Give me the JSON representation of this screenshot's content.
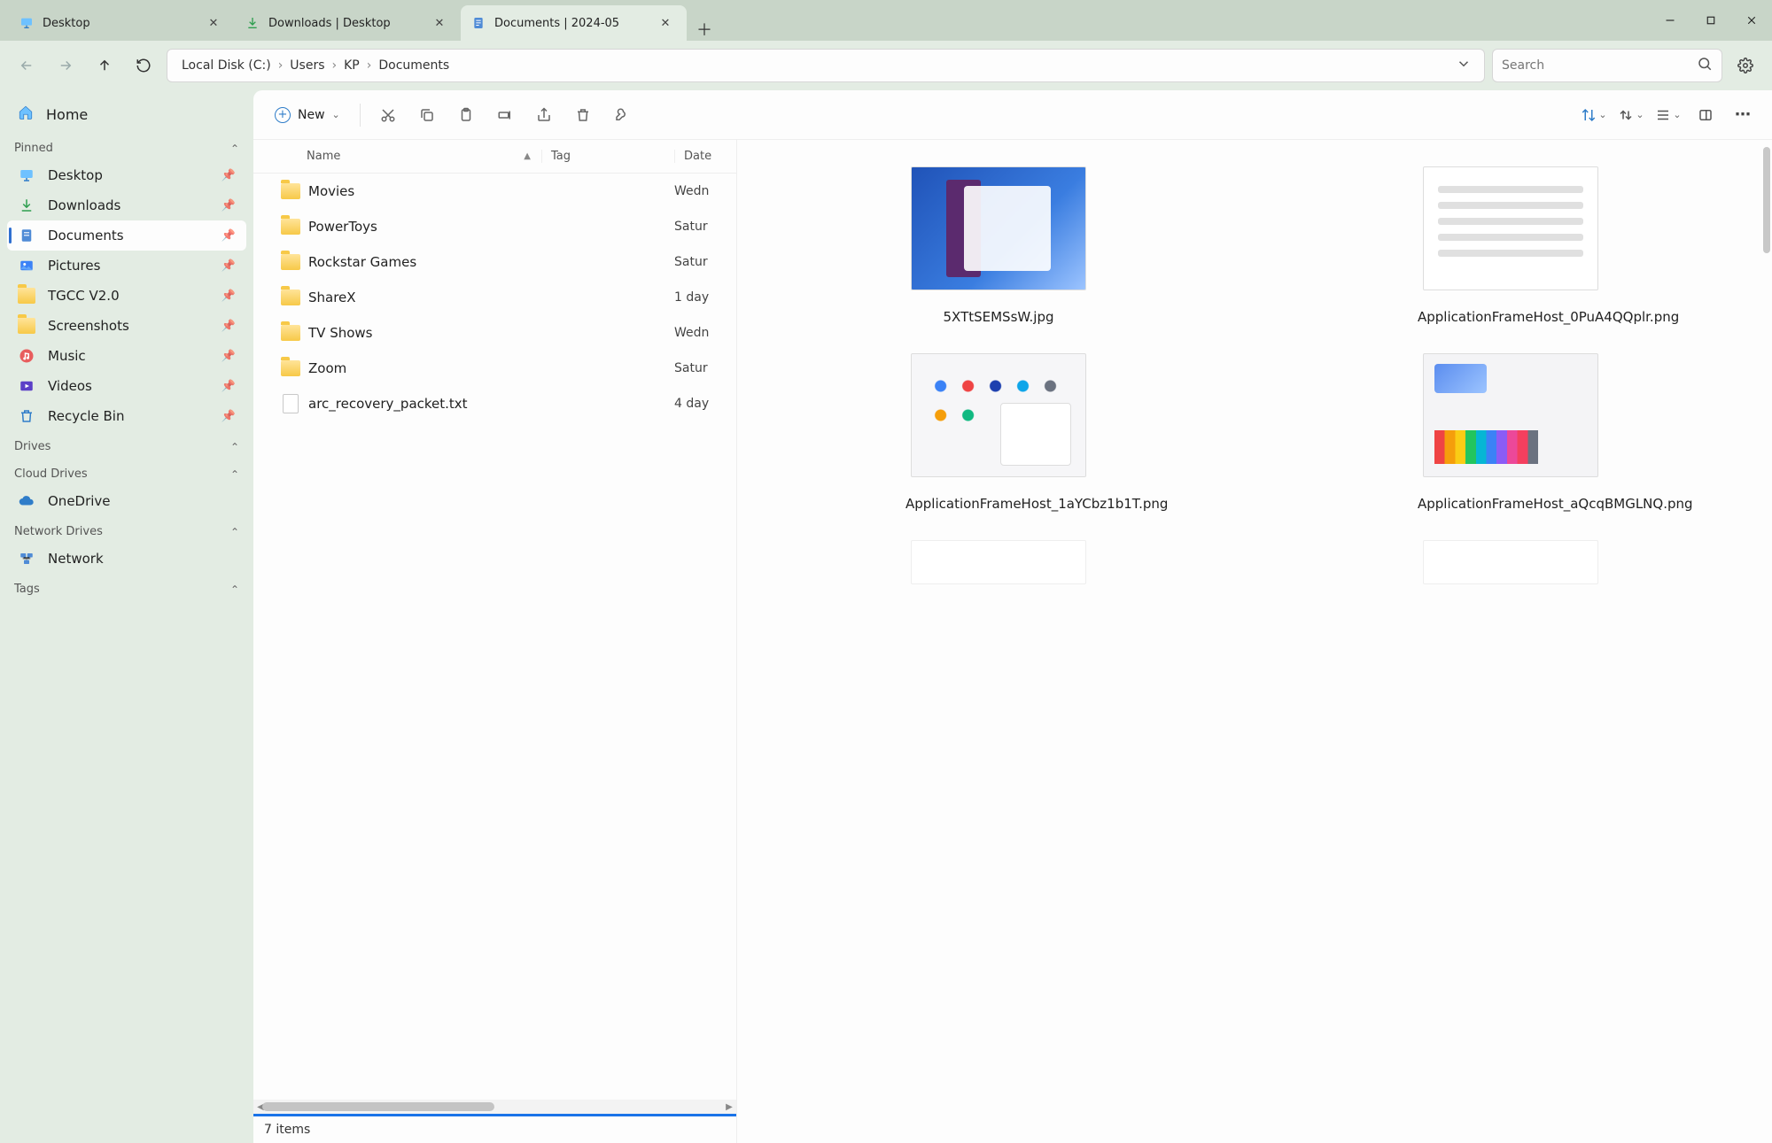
{
  "tabs": [
    {
      "label": "Desktop",
      "icon": "monitor",
      "active": false
    },
    {
      "label": "Downloads | Desktop",
      "icon": "download",
      "active": false
    },
    {
      "label": "Documents | 2024-05",
      "icon": "document",
      "active": true
    }
  ],
  "breadcrumb": [
    "Local Disk (C:)",
    "Users",
    "KP",
    "Documents"
  ],
  "search": {
    "placeholder": "Search"
  },
  "toolbar": {
    "new_label": "New"
  },
  "sidebar": {
    "home_label": "Home",
    "sections": {
      "pinned": {
        "title": "Pinned",
        "items": [
          {
            "label": "Desktop",
            "icon": "monitor"
          },
          {
            "label": "Downloads",
            "icon": "download"
          },
          {
            "label": "Documents",
            "icon": "document",
            "selected": true
          },
          {
            "label": "Pictures",
            "icon": "pictures"
          },
          {
            "label": "TGCC V2.0",
            "icon": "folder"
          },
          {
            "label": "Screenshots",
            "icon": "folder"
          },
          {
            "label": "Music",
            "icon": "music"
          },
          {
            "label": "Videos",
            "icon": "video"
          },
          {
            "label": "Recycle Bin",
            "icon": "recycle"
          }
        ]
      },
      "drives": {
        "title": "Drives"
      },
      "cloud": {
        "title": "Cloud Drives",
        "items": [
          {
            "label": "OneDrive",
            "icon": "cloud"
          }
        ]
      },
      "network": {
        "title": "Network Drives",
        "items": [
          {
            "label": "Network",
            "icon": "network"
          }
        ]
      },
      "tags": {
        "title": "Tags"
      }
    }
  },
  "columns": {
    "name": "Name",
    "tag": "Tag",
    "date": "Date"
  },
  "rows": [
    {
      "name": "Movies",
      "type": "folder",
      "date": "Wedn"
    },
    {
      "name": "PowerToys",
      "type": "folder",
      "date": "Satur"
    },
    {
      "name": "Rockstar Games",
      "type": "folder",
      "date": "Satur"
    },
    {
      "name": "ShareX",
      "type": "folder",
      "date": "1 day"
    },
    {
      "name": "TV Shows",
      "type": "folder",
      "date": "Wedn"
    },
    {
      "name": "Zoom",
      "type": "folder",
      "date": "Satur"
    },
    {
      "name": "arc_recovery_packet.txt",
      "type": "file",
      "date": "4 day"
    }
  ],
  "thumbnails": [
    {
      "label": "5XTtSEMSsW.jpg",
      "style": "t1"
    },
    {
      "label": "ApplicationFrameHost_0PuA4QQplr.png",
      "style": "t2"
    },
    {
      "label": "ApplicationFrameHost_1aYCbz1b1T.png",
      "style": "t3"
    },
    {
      "label": "ApplicationFrameHost_aQcqBMGLNQ.png",
      "style": "t4"
    }
  ],
  "status": "7 items"
}
